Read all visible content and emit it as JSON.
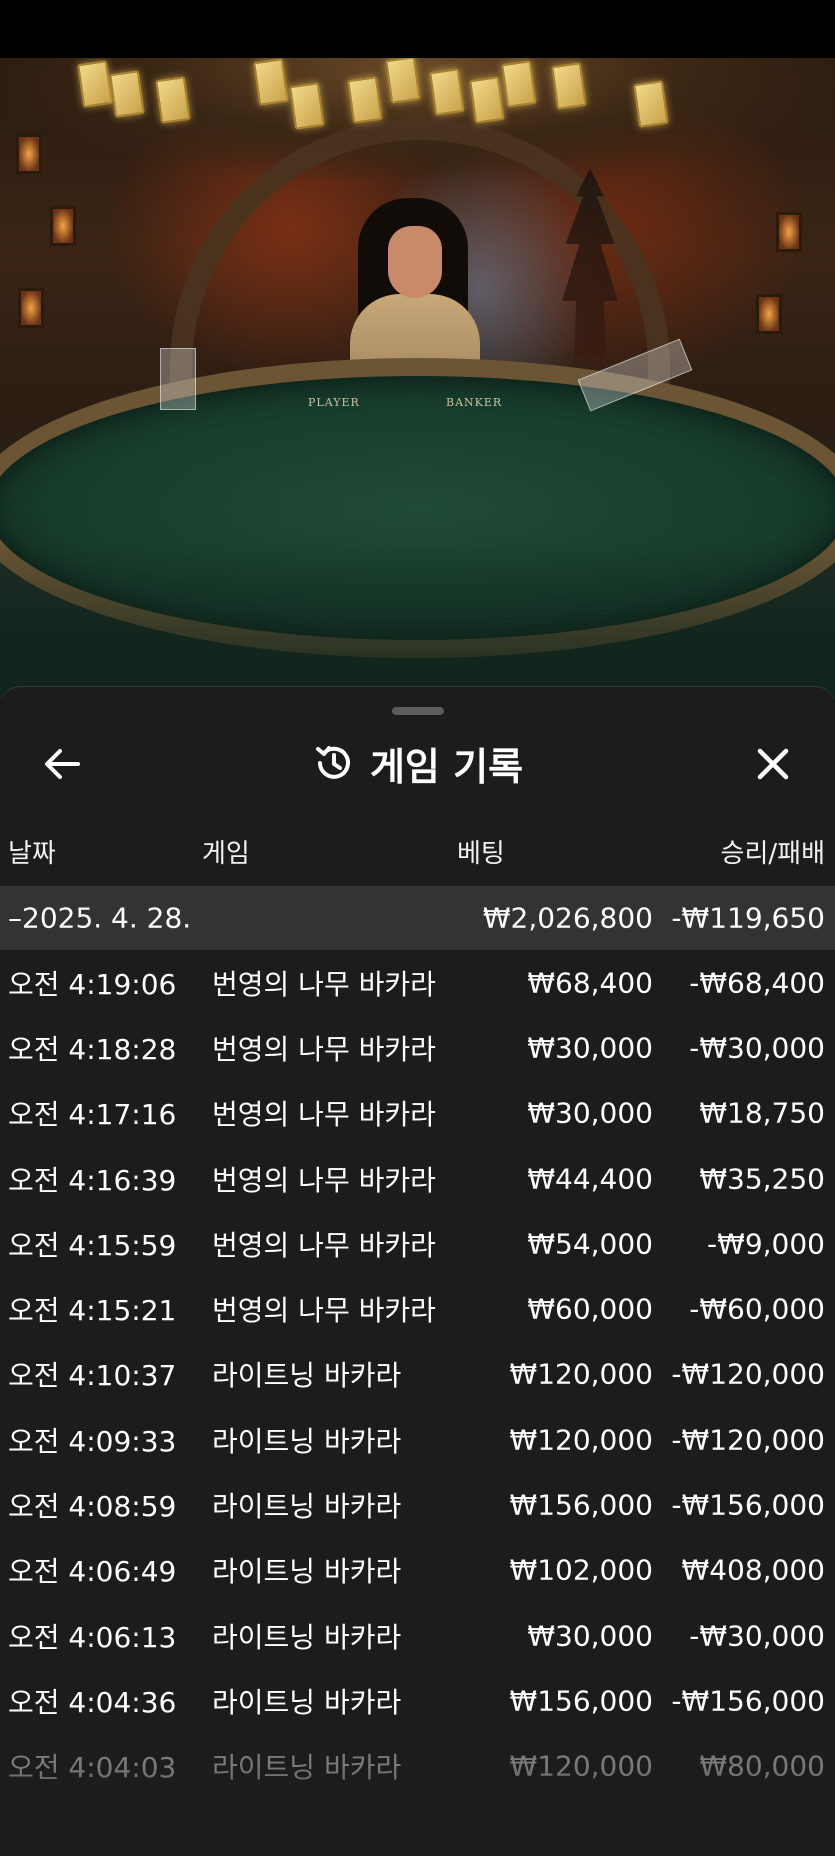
{
  "video": {
    "table_labels": {
      "player": "PLAYER",
      "banker": "BANKER"
    }
  },
  "sheet": {
    "title": "게임 기록",
    "icons": {
      "back": "arrow-left-icon",
      "history": "history-clock-icon",
      "close": "close-icon"
    },
    "columns": {
      "date": "날짜",
      "game": "게임",
      "bet": "베팅",
      "result": "승리/패배"
    },
    "date_group": {
      "date": "–2025. 4. 28.",
      "bet_total": "₩2,026,800",
      "result_total": "-₩119,650"
    },
    "rows": [
      {
        "time": "오전 4:19:06",
        "game": "번영의 나무 바카라",
        "bet": "₩68,400",
        "result": "-₩68,400"
      },
      {
        "time": "오전 4:18:28",
        "game": "번영의 나무 바카라",
        "bet": "₩30,000",
        "result": "-₩30,000"
      },
      {
        "time": "오전 4:17:16",
        "game": "번영의 나무 바카라",
        "bet": "₩30,000",
        "result": "₩18,750"
      },
      {
        "time": "오전 4:16:39",
        "game": "번영의 나무 바카라",
        "bet": "₩44,400",
        "result": "₩35,250"
      },
      {
        "time": "오전 4:15:59",
        "game": "번영의 나무 바카라",
        "bet": "₩54,000",
        "result": "-₩9,000"
      },
      {
        "time": "오전 4:15:21",
        "game": "번영의 나무 바카라",
        "bet": "₩60,000",
        "result": "-₩60,000"
      },
      {
        "time": "오전 4:10:37",
        "game": "라이트닝 바카라",
        "bet": "₩120,000",
        "result": "-₩120,000"
      },
      {
        "time": "오전 4:09:33",
        "game": "라이트닝 바카라",
        "bet": "₩120,000",
        "result": "-₩120,000"
      },
      {
        "time": "오전 4:08:59",
        "game": "라이트닝 바카라",
        "bet": "₩156,000",
        "result": "-₩156,000"
      },
      {
        "time": "오전 4:06:49",
        "game": "라이트닝 바카라",
        "bet": "₩102,000",
        "result": "₩408,000"
      },
      {
        "time": "오전 4:06:13",
        "game": "라이트닝 바카라",
        "bet": "₩30,000",
        "result": "-₩30,000"
      },
      {
        "time": "오전 4:04:36",
        "game": "라이트닝 바카라",
        "bet": "₩156,000",
        "result": "-₩156,000"
      },
      {
        "time": "오전 4:04:03",
        "game": "라이트닝 바카라",
        "bet": "₩120,000",
        "result": "₩80,000"
      }
    ]
  }
}
